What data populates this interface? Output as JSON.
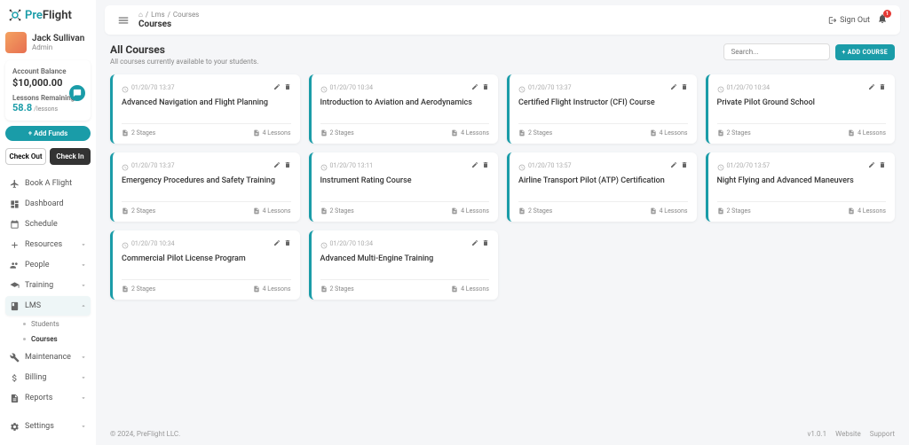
{
  "brand": {
    "pre": "Pre",
    "flight": "Flight"
  },
  "user": {
    "name": "Jack Sullivan",
    "role": "Admin"
  },
  "account": {
    "balance_label": "Account Balance",
    "balance": "$10,000.00",
    "lessons_label": "Lessons Remaining",
    "lessons_num": "58.8",
    "lessons_unit": "/lessons",
    "add_funds": "+ Add Funds"
  },
  "check": {
    "out": "Check Out",
    "in": "Check In"
  },
  "nav": {
    "book": "Book A Flight",
    "dashboard": "Dashboard",
    "schedule": "Schedule",
    "resources": "Resources",
    "people": "People",
    "training": "Training",
    "lms": "LMS",
    "students": "Students",
    "courses": "Courses",
    "maintenance": "Maintenance",
    "billing": "Billing",
    "reports": "Reports",
    "settings": "Settings"
  },
  "topbar": {
    "crumb_home": "⌂",
    "crumb_lms": "Lms",
    "crumb_courses": "Courses",
    "title": "Courses",
    "signout": "Sign Out",
    "notif_count": "1"
  },
  "header": {
    "title": "All Courses",
    "sub": "All courses currently available to your students.",
    "search_placeholder": "Search...",
    "add": "+ ADD COURSE"
  },
  "courses": [
    {
      "date": "01/20/70 13:37",
      "title": "Advanced Navigation and Flight Planning",
      "stages": "2 Stages",
      "lessons": "4 Lessons"
    },
    {
      "date": "01/20/70 10:34",
      "title": "Introduction to Aviation and Aerodynamics",
      "stages": "2 Stages",
      "lessons": "4 Lessons"
    },
    {
      "date": "01/20/70 13:37",
      "title": "Certified Flight Instructor (CFI) Course",
      "stages": "2 Stages",
      "lessons": "4 Lessons"
    },
    {
      "date": "01/20/70 10:34",
      "title": "Private Pilot Ground School",
      "stages": "2 Stages",
      "lessons": "4 Lessons"
    },
    {
      "date": "01/20/70 13:37",
      "title": "Emergency Procedures and Safety Training",
      "stages": "2 Stages",
      "lessons": "4 Lessons"
    },
    {
      "date": "01/20/70 13:11",
      "title": "Instrument Rating Course",
      "stages": "2 Stages",
      "lessons": "4 Lessons"
    },
    {
      "date": "01/20/70 13:57",
      "title": "Airline Transport Pilot (ATP) Certification",
      "stages": "2 Stages",
      "lessons": "4 Lessons"
    },
    {
      "date": "01/20/70 13:57",
      "title": "Night Flying and Advanced Maneuvers",
      "stages": "2 Stages",
      "lessons": "4 Lessons"
    },
    {
      "date": "01/20/70 10:34",
      "title": "Commercial Pilot License Program",
      "stages": "2 Stages",
      "lessons": "4 Lessons"
    },
    {
      "date": "01/20/70 10:34",
      "title": "Advanced Multi-Engine Training",
      "stages": "2 Stages",
      "lessons": "4 Lessons"
    }
  ],
  "footer": {
    "copyright": "© 2024, PreFlight LLC.",
    "version": "v1.0.1",
    "website": "Website",
    "support": "Support"
  }
}
